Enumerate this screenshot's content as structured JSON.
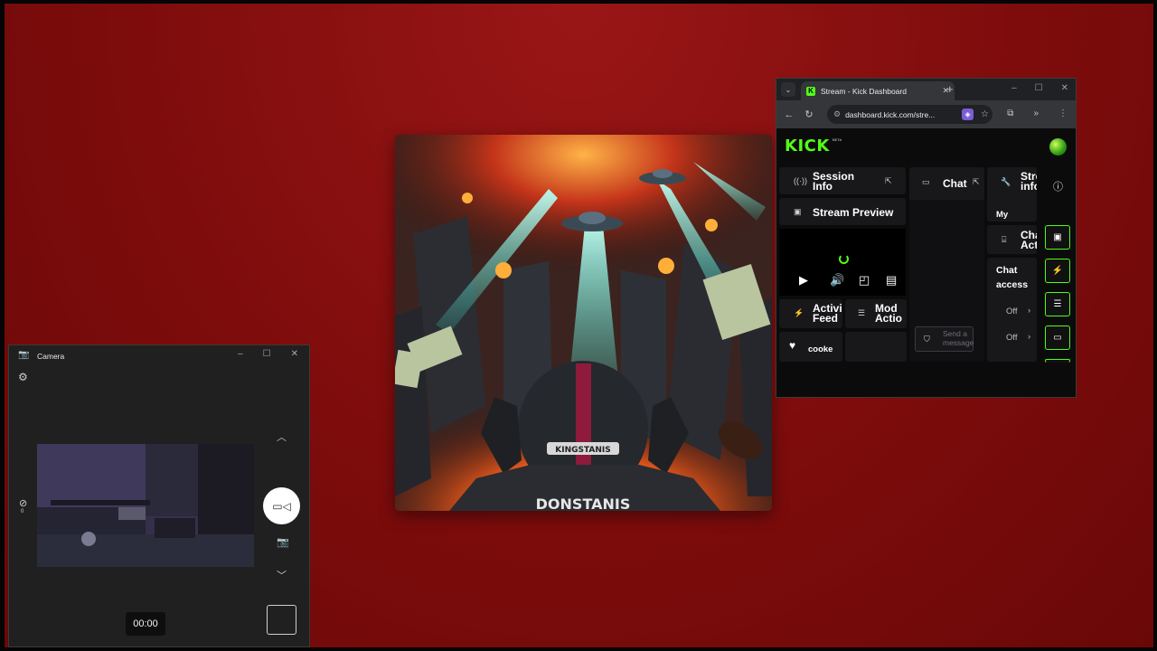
{
  "browser": {
    "tab_title": "Stream - Kick Dashboard",
    "tab_favicon": "K",
    "tab_close": "✕",
    "new_tab": "+",
    "url": "dashboard.kick.com/stre...",
    "window_controls": {
      "minimize": "–",
      "maximize": "☐",
      "close": "✕"
    },
    "nav": {
      "back": "←",
      "reload": "↻",
      "more_tools": "»",
      "menu": "⋮"
    }
  },
  "kick": {
    "logo": "KICK",
    "logo_badge": "BETA",
    "colors": {
      "brand": "#53fc18",
      "panel": "#18181b",
      "background": "#0b0b0b"
    },
    "panels": {
      "session_info": {
        "title_line1": "Session",
        "title_line2": "Info",
        "icon": "broadcast-icon"
      },
      "stream_preview": {
        "title": "Stream Preview",
        "icon": "preview-icon"
      },
      "chat": {
        "title": "Chat",
        "icon": "chat-icon",
        "input_placeholder_line1": "Send a",
        "input_placeholder_line2": "message"
      },
      "stream_info": {
        "title_line1": "Stre",
        "title_line2": "info",
        "subtitle": "My"
      },
      "activity_feed": {
        "title_line1": "Activi",
        "title_line2": "Feed",
        "icon": "lightning-icon"
      },
      "mod_actions": {
        "title_line1": "Mod",
        "title_line2": "Actio",
        "icon": "list-icon"
      },
      "cookie": {
        "label": "cooke",
        "icon": "heart-icon"
      },
      "chat_actions": {
        "title_line1": "Cha",
        "title_line2": "Act",
        "icon": "chat-actions-icon"
      },
      "chat_access": {
        "title_line1": "Chat",
        "title_line2": "access",
        "rows": [
          "Off",
          "Off"
        ]
      }
    }
  },
  "camera": {
    "title": "Camera",
    "timer": "00:00",
    "side_count": "0"
  },
  "artwork": {
    "jersey_text": "DONSTANIS",
    "helmet_text": "KINGSTANIS"
  }
}
